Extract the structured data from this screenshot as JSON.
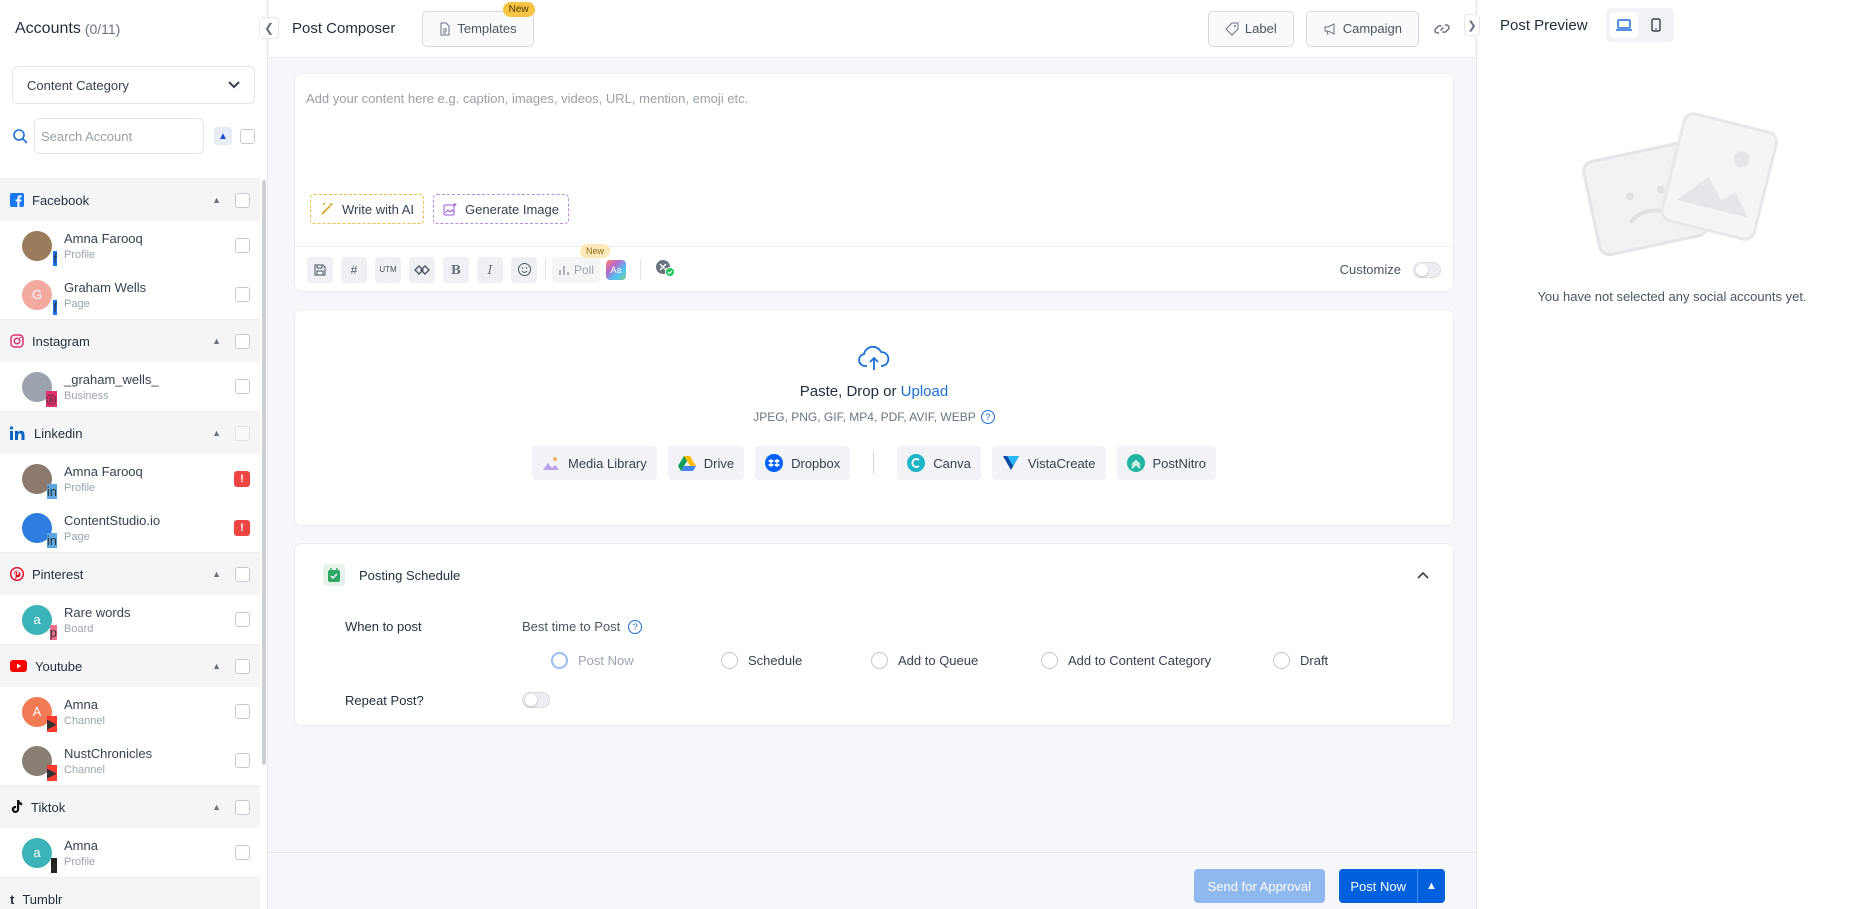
{
  "sidebar": {
    "title": "Accounts",
    "count": "(0/11)",
    "category_select": "Content Category",
    "search_placeholder": "Search Account",
    "groups": [
      {
        "name": "Facebook",
        "icon": "facebook-icon",
        "color": "#1877f2",
        "accounts": [
          {
            "name": "Amna Farooq",
            "type": "Profile",
            "avatar_color": "#9a7b5b",
            "initial": "",
            "badge_color": "#1877f2",
            "badge": "f",
            "warning": false
          },
          {
            "name": "Graham Wells",
            "type": "Page",
            "avatar_color": "#f1a9a0",
            "initial": "G",
            "badge_color": "#1877f2",
            "badge": "f",
            "warning": false
          }
        ]
      },
      {
        "name": "Instagram",
        "icon": "instagram-icon",
        "color": "#e1306c",
        "accounts": [
          {
            "name": "_graham_wells_",
            "type": "Business",
            "avatar_color": "#9ca3af",
            "initial": "",
            "badge_color": "#e1306c",
            "badge": "◎",
            "warning": false
          }
        ]
      },
      {
        "name": "Linkedin",
        "icon": "linkedin-icon",
        "color": "#0a66c2",
        "accounts": [
          {
            "name": "Amna Farooq",
            "type": "Profile",
            "avatar_color": "#8d7a6c",
            "initial": "",
            "badge_color": "#5ba6e0",
            "badge": "in",
            "warning": true
          },
          {
            "name": "ContentStudio.io",
            "type": "Page",
            "avatar_color": "#2f7de1",
            "initial": "",
            "badge_color": "#5ba6e0",
            "badge": "in",
            "warning": true
          }
        ]
      },
      {
        "name": "Pinterest",
        "icon": "pinterest-icon",
        "color": "#e60023",
        "accounts": [
          {
            "name": "Rare words",
            "type": "Board",
            "avatar_color": "#3bb3b8",
            "initial": "a",
            "badge_color": "#ee6f8c",
            "badge": "p",
            "warning": false
          }
        ]
      },
      {
        "name": "Youtube",
        "icon": "youtube-icon",
        "color": "#ff0000",
        "accounts": [
          {
            "name": "Amna",
            "type": "Channel",
            "avatar_color": "#f27a54",
            "initial": "A",
            "badge_color": "#ff3b30",
            "badge": "▶",
            "warning": false
          },
          {
            "name": "NustChronicles",
            "type": "Channel",
            "avatar_color": "#8a7f74",
            "initial": "",
            "badge_color": "#ff3b30",
            "badge": "▶",
            "warning": false
          }
        ]
      },
      {
        "name": "Tiktok",
        "icon": "tiktok-icon",
        "color": "#111111",
        "accounts": [
          {
            "name": "Amna",
            "type": "Profile",
            "avatar_color": "#3bb3b8",
            "initial": "a",
            "badge_color": "#222222",
            "badge": "♪",
            "warning": false
          }
        ]
      }
    ],
    "last_group_partial": "Tumblr"
  },
  "header": {
    "title": "Post Composer",
    "templates_label": "Templates",
    "templates_tag": "New",
    "label_btn": "Label",
    "campaign_btn": "Campaign"
  },
  "editor": {
    "placeholder": "Add your content here e.g. caption, images, videos, URL, mention, emoji etc.",
    "write_ai": "Write with AI",
    "generate_image": "Generate Image",
    "toolbar": {
      "utm": "UTM",
      "bold": "B",
      "italic": "I",
      "poll": "Poll",
      "poll_tag": "New",
      "aa": "Aa",
      "customize": "Customize"
    }
  },
  "media": {
    "paste_text": "Paste, Drop or ",
    "upload_link": "Upload",
    "formats": "JPEG, PNG, GIF, MP4, PDF, AVIF, WEBP",
    "help": "?",
    "sources": [
      "Media Library",
      "Drive",
      "Dropbox",
      "Canva",
      "VistaCreate",
      "PostNitro"
    ]
  },
  "schedule": {
    "title": "Posting Schedule",
    "when_label": "When to post",
    "best_time": "Best time to Post",
    "options": [
      "Post Now",
      "Schedule",
      "Add to Queue",
      "Add to Content Category",
      "Draft"
    ],
    "selected": "Post Now",
    "repeat_label": "Repeat Post?"
  },
  "footer": {
    "approval": "Send for Approval",
    "post_now": "Post Now"
  },
  "preview": {
    "title": "Post Preview",
    "empty_text": "You have not selected any social accounts yet."
  },
  "colors": {
    "primary": "#0061df",
    "primary_light": "#8fb8ee",
    "warning": "#ef4444",
    "new_tag": "#f6c343"
  }
}
